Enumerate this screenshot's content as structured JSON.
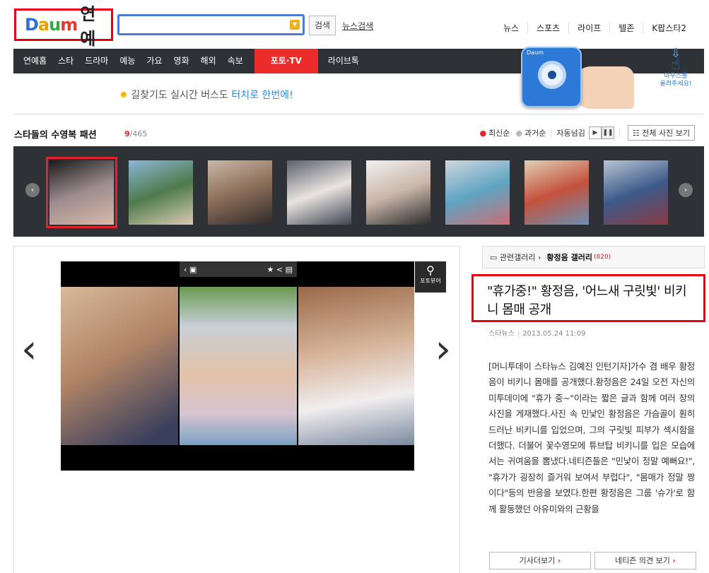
{
  "header": {
    "logo_brand": "Daum",
    "logo_section": "연예",
    "search_value": "",
    "search_button": "검색",
    "news_search": "뉴스검색",
    "top_links": [
      "뉴스",
      "스포츠",
      "라이프",
      "텔존",
      "K팝스타2"
    ]
  },
  "nav": {
    "items": [
      "연예홈",
      "스타",
      "드라마",
      "예능",
      "가요",
      "영화",
      "해외",
      "속보"
    ],
    "active": "포토·TV",
    "after": "라이브톡"
  },
  "banner": {
    "text_prefix": "길찾기도 실시간 버스도 ",
    "text_highlight": "터치로 한번에!",
    "cam_label": "Daum",
    "mouse_hint_line1": "마우스를",
    "mouse_hint_line2": "올려주세요!"
  },
  "gallery": {
    "title": "스타들의 수영복 패션",
    "current": "9",
    "total": "/465",
    "sort_latest": "최신순",
    "sort_past": "과거순",
    "auto_label": "자동넘김",
    "view_all": "전체 사진 보기",
    "thumbnails": [
      {
        "colors": [
          "#1a1a1a",
          "#9d8c8f",
          "#d9b9a7"
        ],
        "selected": true
      },
      {
        "colors": [
          "#8bb7d6",
          "#4f7a4d",
          "#d9cbb3"
        ],
        "selected": false
      },
      {
        "colors": [
          "#c9b9a6",
          "#8a6c58",
          "#2e2a2a"
        ],
        "selected": false
      },
      {
        "colors": [
          "#5b5f6e",
          "#e9e4e0",
          "#3f4452"
        ],
        "selected": false
      },
      {
        "colors": [
          "#f1f1f1",
          "#c9b6aa",
          "#2c2c2c"
        ],
        "selected": false
      },
      {
        "colors": [
          "#d0d7dd",
          "#5fa4c3",
          "#c86f75"
        ],
        "selected": false
      },
      {
        "colors": [
          "#e0d0b5",
          "#c4523d",
          "#6b8fb3"
        ],
        "selected": false
      },
      {
        "colors": [
          "#b9c4d3",
          "#3c5a8a",
          "#8a3a44"
        ],
        "selected": false
      }
    ]
  },
  "photo": {
    "viewer_label": "포토뷰어"
  },
  "article": {
    "related_label": "관련갤러리",
    "gallery_name": "황정음 갤러리",
    "gallery_count": "(820)",
    "headline": "\"휴가중!\" 황정음, '어느새 구릿빛' 비키니 몸매 공개",
    "source": "스타뉴스",
    "date": "2013.05.24 11:09",
    "body": "[머니투데이 스타뉴스 김예진 인턴기자]가수 겸 배우 황정음이 비키니 몸매를 공개했다.황정음은 24일 오전 자신의 미투데이에 \"휴가 중~\"이라는 짧은 글과 함께 여러 장의 사진을 게재했다.사진 속 민낯인 황정음은 가슴골이 훤히 드러난 비키니를 입었으며, 그의 구릿빛 피부가 섹시함을 더했다. 더불어 꽃수영모에 튜브탑 비키니를 입은 모습에서는 귀여움을 뽐냈다.네티즌들은 \"민낯이 정말 예뻐요!\", \"휴가가 굉장히 즐거워 보여서 부럽다\", \"몸매가 정말 짱이다\"등의 반응을 보였다.한편 황정음은 그룹 '슈가'로 함께 활동했던 아유미와의 근황을",
    "btn_more": "기사더보기",
    "btn_comments": "네티즌 의견 보기"
  }
}
